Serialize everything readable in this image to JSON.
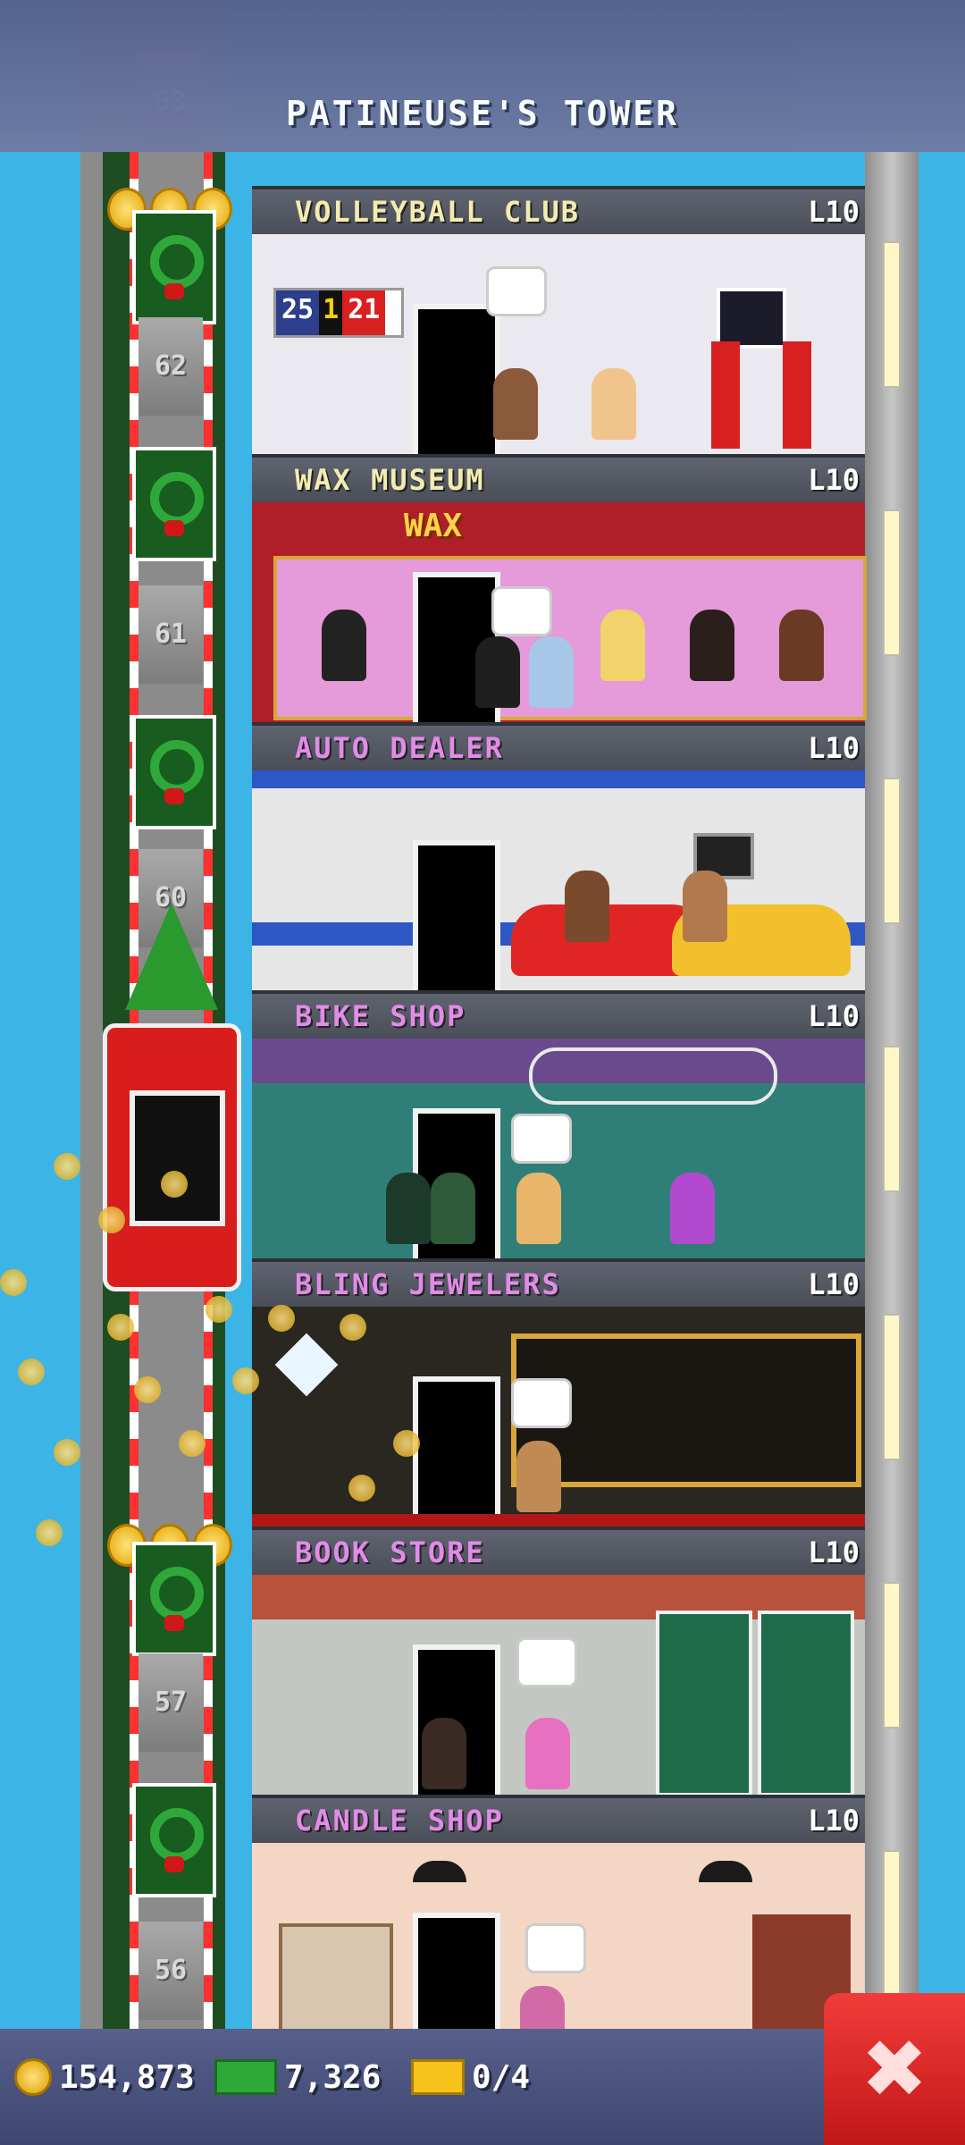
{
  "header": {
    "title": "PATINEUSE'S TOWER"
  },
  "shaft": {
    "floor_numbers": [
      "63",
      "62",
      "61",
      "60",
      "57",
      "56"
    ]
  },
  "floors": [
    {
      "name": "VOLLEYBALL CLUB",
      "level": "L10",
      "name_color": "#f3ecb0",
      "room_color": "#e9e9ef",
      "scoreboard_left": "25",
      "scoreboard_mid": "1",
      "scoreboard_right": "21"
    },
    {
      "name": "WAX MUSEUM",
      "level": "L10",
      "name_color": "#f3ecb0",
      "room_color": "#b01e2a",
      "sign": "WAX"
    },
    {
      "name": "AUTO DEALER",
      "level": "L10",
      "name_color": "#e28be8",
      "room_color": "#e6e6e6"
    },
    {
      "name": "BIKE SHOP",
      "level": "L10",
      "name_color": "#e28be8",
      "room_color": "#2f7f78"
    },
    {
      "name": "BLING JEWELERS",
      "level": "L10",
      "name_color": "#e28be8",
      "room_color": "#2a2620"
    },
    {
      "name": "BOOK STORE",
      "level": "L10",
      "name_color": "#e28be8",
      "room_color": "#c3c7c2"
    },
    {
      "name": "CANDLE SHOP",
      "level": "L10",
      "name_color": "#e28be8",
      "room_color": "#f3d7c4"
    }
  ],
  "bottom_bar": {
    "coins": "154,873",
    "bux": "7,326",
    "tickets": "0/4"
  },
  "icons": {
    "coin": "coin-icon",
    "bux": "cash-icon",
    "ticket": "ticket-icon",
    "close": "close-icon"
  },
  "colors": {
    "sky": "#3cb4e6",
    "accent_red": "#d81d1d",
    "header": "#5c6690"
  }
}
